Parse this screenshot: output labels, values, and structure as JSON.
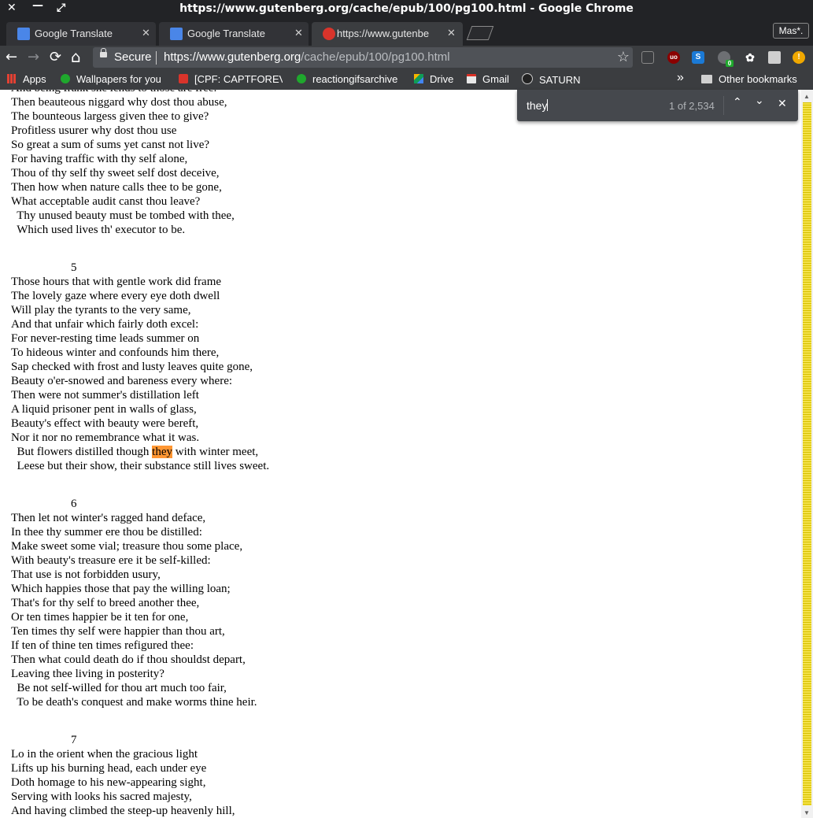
{
  "window": {
    "title": "https://www.gutenberg.org/cache/epub/100/pg100.html - Google Chrome",
    "close_glyph": "✕",
    "minimize_glyph": "—",
    "maximize_glyph": "⤢"
  },
  "tabs": [
    {
      "label": "Google Translate",
      "favicon": "google-translate-icon",
      "close": "✕"
    },
    {
      "label": "Google Translate",
      "favicon": "google-translate-icon",
      "close": "✕"
    },
    {
      "label": "https://www.gutenbe",
      "favicon": "gutenberg-icon",
      "close": "✕",
      "active": true
    }
  ],
  "profile": {
    "label": "Mas*."
  },
  "toolbar": {
    "back": "←",
    "forward": "→",
    "reload": "⟳",
    "home": "⌂",
    "secure_label": "Secure",
    "url_host": "https://www.gutenberg.org",
    "url_path": "/cache/epub/100/pg100.html",
    "star": "☆"
  },
  "extensions": [
    {
      "name": "mouse-icon",
      "badge": ""
    },
    {
      "name": "ublock-icon",
      "badge": "uo"
    },
    {
      "name": "skype-icon",
      "badge": "S"
    },
    {
      "name": "cloud-sync-icon",
      "badge": "0"
    },
    {
      "name": "gnome-icon",
      "badge": ""
    },
    {
      "name": "reader-icon",
      "badge": ""
    },
    {
      "name": "warning-icon",
      "badge": "!"
    }
  ],
  "bookmarks": {
    "apps": "Apps",
    "items": [
      "Wallpapers for you",
      "[CPF: CAPTFOREVER",
      "reactiongifsarchive",
      "Drive",
      "Gmail",
      "SATURN"
    ],
    "overflow": "»",
    "other": "Other bookmarks"
  },
  "find": {
    "query": "they",
    "count": "1 of 2,534",
    "prev": "⌃",
    "next": "⌄",
    "close": "✕"
  },
  "poems": {
    "top_lines": [
      "And being frank she lends to those are free:",
      "Then beauteous niggard why dost thou abuse,",
      "The bounteous largess given thee to give?",
      "Profitless usurer why dost thou use",
      "So great a sum of sums yet canst not live?",
      "For having traffic with thy self alone,",
      "Thou of thy self thy sweet self dost deceive,",
      "Then how when nature calls thee to be gone,",
      "What acceptable audit canst thou leave?",
      "  Thy unused beauty must be tombed with thee,",
      "  Which used lives th' executor to be."
    ],
    "sonnet5": {
      "number": "5",
      "lines": [
        "Those hours that with gentle work did frame",
        "The lovely gaze where every eye doth dwell",
        "Will play the tyrants to the very same,",
        "And that unfair which fairly doth excel:",
        "For never-resting time leads summer on",
        "To hideous winter and confounds him there,",
        "Sap checked with frost and lusty leaves quite gone,",
        "Beauty o'er-snowed and bareness every where:",
        "Then were not summer's distillation left",
        "A liquid prisoner pent in walls of glass,",
        "Beauty's effect with beauty were bereft,",
        "Nor it nor no remembrance what it was."
      ],
      "hl_before": "  But flowers distilled though ",
      "hl_word": "they",
      "hl_after": " with winter meet,",
      "last_line": "  Leese but their show, their substance still lives sweet."
    },
    "sonnet6": {
      "number": "6",
      "lines": [
        "Then let not winter's ragged hand deface,",
        "In thee thy summer ere thou be distilled:",
        "Make sweet some vial; treasure thou some place,",
        "With beauty's treasure ere it be self-killed:",
        "That use is not forbidden usury,",
        "Which happies those that pay the willing loan;",
        "That's for thy self to breed another thee,",
        "Or ten times happier be it ten for one,",
        "Ten times thy self were happier than thou art,",
        "If ten of thine ten times refigured thee:",
        "Then what could death do if thou shouldst depart,",
        "Leaving thee living in posterity?",
        "  Be not self-willed for thou art much too fair,",
        "  To be death's conquest and make worms thine heir."
      ]
    },
    "sonnet7": {
      "number": "7",
      "lines": [
        "Lo in the orient when the gracious light",
        "Lifts up his burning head, each under eye",
        "Doth homage to his new-appearing sight,",
        "Serving with looks his sacred majesty,",
        "And having climbed the steep-up heavenly hill,"
      ]
    }
  },
  "scrollbar": {
    "up": "▲",
    "down": "▼"
  },
  "colors": {
    "highlight": "#ff9632",
    "chrome_dark": "#222326",
    "toolbar": "#3b3d40",
    "scroll_marks": "#e6d200"
  }
}
